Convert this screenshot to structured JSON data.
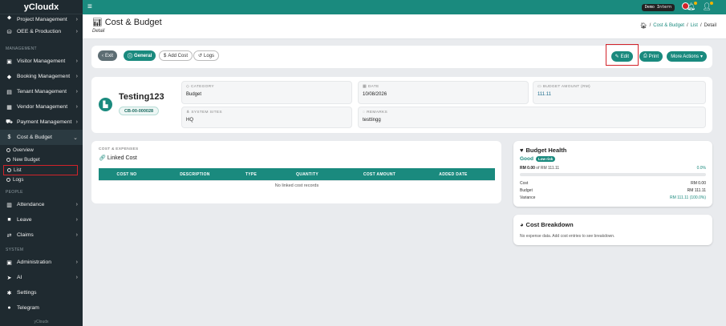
{
  "app": {
    "brand": "yCloudx"
  },
  "topbar": {
    "user_chip": "Demo Intern",
    "avatar_count": "2"
  },
  "sidebar": {
    "items_top": [
      {
        "label": "Project Management",
        "icon": "pin-icon"
      },
      {
        "label": "OEE & Production",
        "icon": "chart-line-icon"
      }
    ],
    "section_management": "MANAGEMENT",
    "items_mgmt": [
      {
        "label": "Visitor Management",
        "icon": "id-card-icon"
      },
      {
        "label": "Booking Management",
        "icon": "tag-icon"
      },
      {
        "label": "Tenant Management",
        "icon": "building-icon"
      },
      {
        "label": "Vendor Management",
        "icon": "vendor-icon"
      },
      {
        "label": "Payment Management",
        "icon": "cart-icon"
      },
      {
        "label": "Cost & Budget",
        "icon": "dollar-icon"
      }
    ],
    "sub_items": [
      {
        "label": "Overview"
      },
      {
        "label": "New Budget"
      },
      {
        "label": "List"
      },
      {
        "label": "Logs"
      }
    ],
    "section_people": "PEOPLE",
    "items_people": [
      {
        "label": "Attendance",
        "icon": "calendar-icon"
      },
      {
        "label": "Leave",
        "icon": "briefcase-icon"
      },
      {
        "label": "Claims",
        "icon": "exchange-icon"
      }
    ],
    "section_system": "SYSTEM",
    "items_system": [
      {
        "label": "Administration",
        "icon": "admin-icon"
      },
      {
        "label": "AI",
        "icon": "send-icon"
      },
      {
        "label": "Settings",
        "icon": "gear-icon"
      },
      {
        "label": "Telegram",
        "icon": "telegram-icon"
      }
    ],
    "footer": "yCloudx"
  },
  "header": {
    "title": "Cost & Budget",
    "subtitle": "Detail",
    "breadcrumb": [
      "Cost & Budget",
      "List",
      "Detail"
    ]
  },
  "toolbar": {
    "exit": "Exit",
    "general": "General",
    "add_cost": "Add Cost",
    "logs": "Logs",
    "edit": "Edit",
    "print": "Print",
    "more": "More Actions"
  },
  "record": {
    "name": "Testing123",
    "code": "CB-00-000028",
    "fields": {
      "category": {
        "label": "CATEGORY",
        "value": "Budget"
      },
      "date": {
        "label": "DATE",
        "value": "10/08/2026"
      },
      "budget_amount": {
        "label": "BUDGET AMOUNT (RM)",
        "value": "111.11"
      },
      "system_sites": {
        "label": "SYSTEM SITES",
        "value": "HQ"
      },
      "remarks": {
        "label": "REMARKS",
        "value": "testtingg"
      }
    }
  },
  "costs": {
    "section_label": "COST & EXPENSES",
    "title": "Linked Cost",
    "columns": [
      "COST NO",
      "DESCRIPTION",
      "TYPE",
      "QUANTITY",
      "COST AMOUNT",
      "ADDED DATE"
    ],
    "empty": "No linked cost records"
  },
  "health": {
    "title": "Budget Health",
    "status": "Good",
    "risk": "Low risk",
    "used": "RM 0.00",
    "of_text": "of RM 111.11",
    "percent": "0.0%",
    "progress": 0,
    "rows": [
      {
        "label": "Cost",
        "value": "RM 0.00"
      },
      {
        "label": "Budget",
        "value": "RM 111.11"
      },
      {
        "label": "Variance",
        "value": "RM 111.11 (100.0%)"
      }
    ]
  },
  "breakdown": {
    "title": "Cost Breakdown",
    "empty": "No expense data. Add cost entries to see breakdown."
  }
}
